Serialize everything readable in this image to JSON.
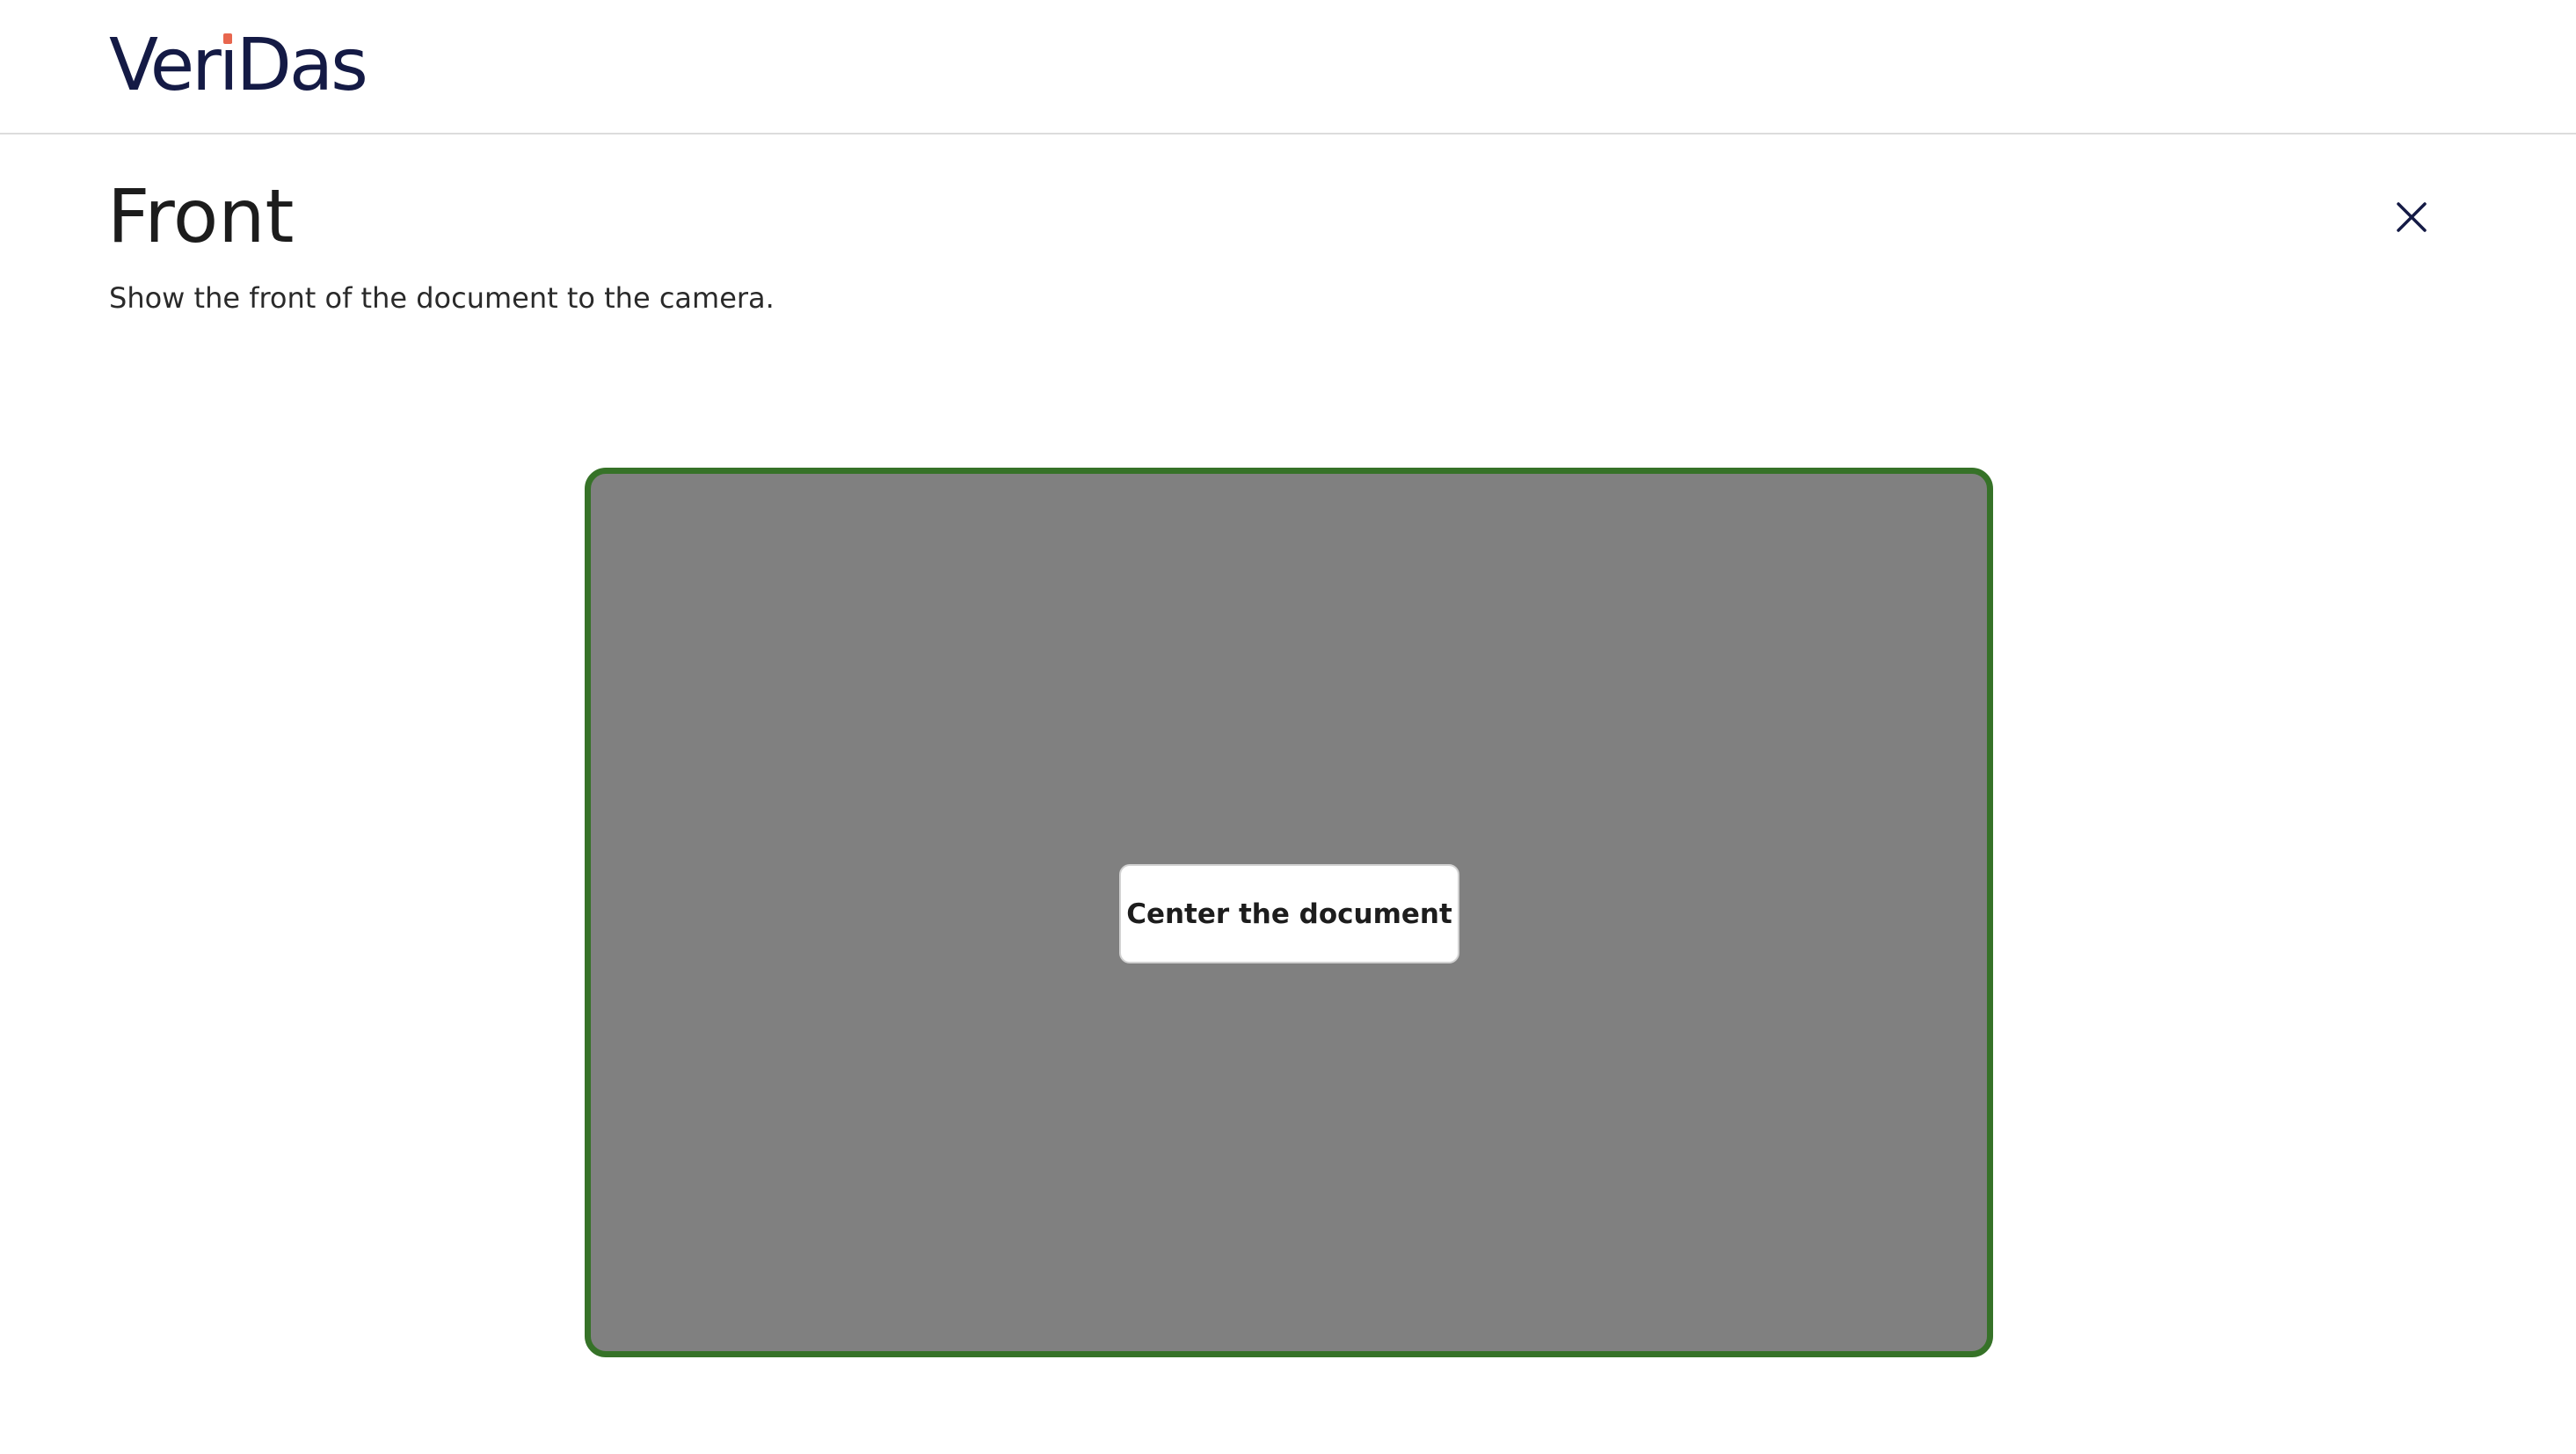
{
  "header": {
    "logo": {
      "text_before_i": "Ver",
      "letter_i": "i",
      "text_after_i": "Das",
      "color": "#141a45",
      "dot_color": "#e8664e"
    }
  },
  "main": {
    "title": "Front",
    "subtitle": "Show the front of the document to the camera.",
    "close_icon": "close-icon"
  },
  "camera": {
    "frame_border_color": "#367228",
    "preview_color": "#808080",
    "hint": "Center the document"
  }
}
